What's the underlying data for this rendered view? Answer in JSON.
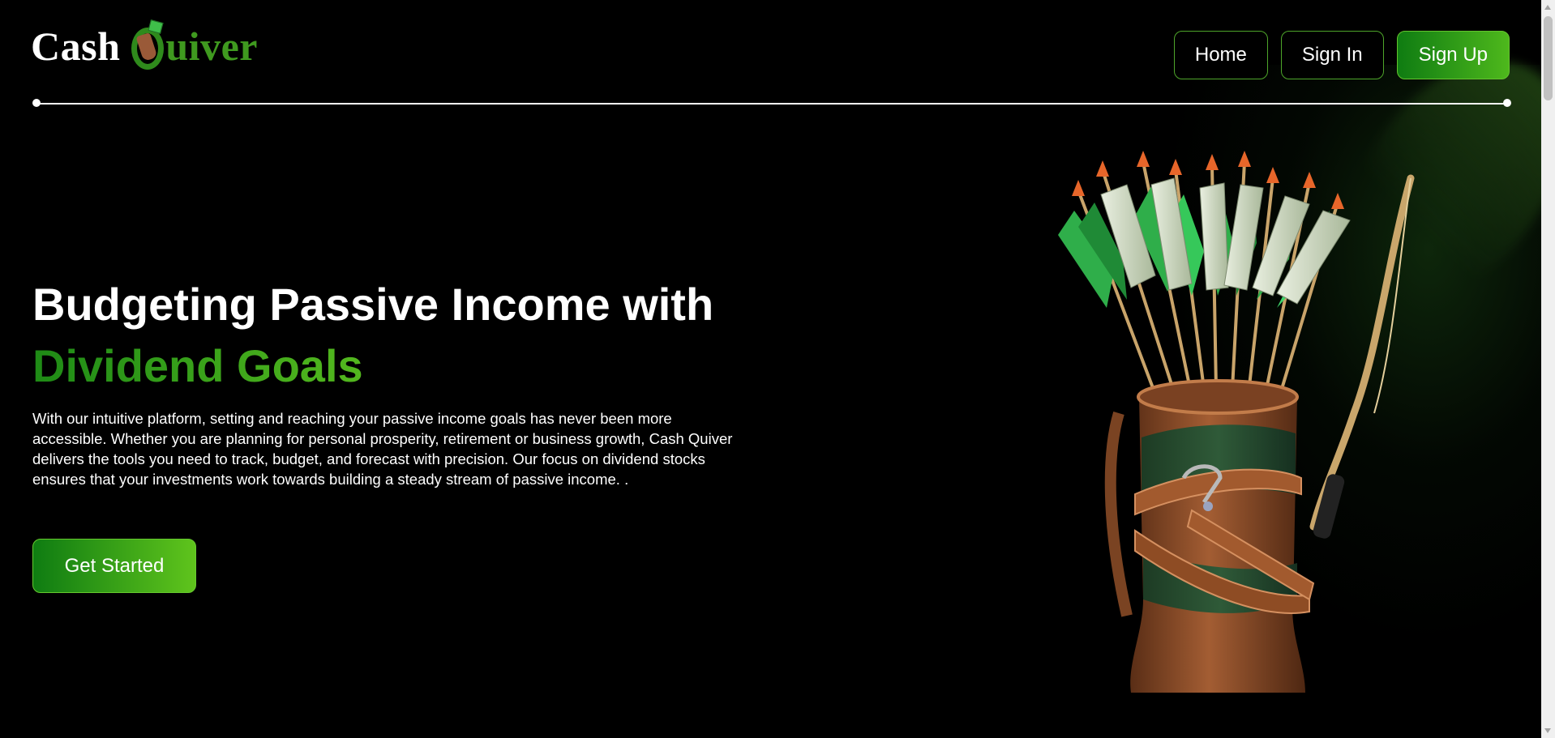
{
  "brand": {
    "word1": "Cash",
    "word2": "Quiver",
    "word2_rest": "uiver"
  },
  "nav": {
    "home": "Home",
    "sign_in": "Sign In",
    "sign_up": "Sign Up"
  },
  "hero": {
    "title_line1": "Budgeting Passive Income with",
    "title_line2": "Dividend Goals",
    "description": "With our intuitive platform, setting and reaching your passive income goals has never been more accessible. Whether you are planning for personal prosperity, retirement or business growth, Cash Quiver delivers the tools you need to track, budget, and forecast with precision. Our focus on dividend stocks ensures that your investments work towards building a steady stream of passive income. .",
    "cta": "Get Started"
  },
  "colors": {
    "background": "#000000",
    "accent_green": "#3f9a1f",
    "accent_gradient_start": "#0f7c12",
    "accent_gradient_end": "#5fc41c"
  },
  "icons": {
    "logo_mark": "quiver-with-cash-icon",
    "hero_art": "quiver-of-money-arrows-illustration"
  }
}
